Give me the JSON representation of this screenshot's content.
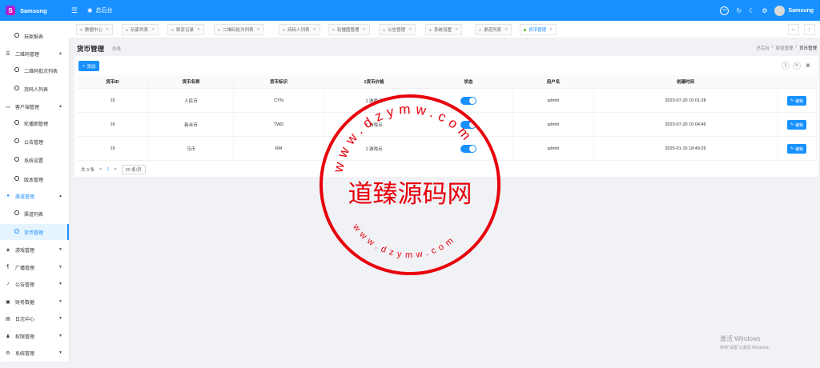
{
  "header": {
    "app_title": "Samsung",
    "crumb": "总后台",
    "user_name": "Samsung",
    "colors": {
      "primary": "#1890ff"
    }
  },
  "sidebar": {
    "items": [
      {
        "label": "玩家报表",
        "type": "child",
        "icon": "circle-icon"
      },
      {
        "label": "二维码管理",
        "type": "parent",
        "icon": "menu-icon",
        "arrow": "^"
      },
      {
        "label": "二维码批次列表",
        "type": "child",
        "icon": "circle-icon"
      },
      {
        "label": "持码人列表",
        "type": "child",
        "icon": "circle-icon"
      },
      {
        "label": "客户端管理",
        "type": "parent",
        "icon": "monitor-icon",
        "arrow": "^"
      },
      {
        "label": "轮播图管理",
        "type": "child",
        "icon": "circle-icon"
      },
      {
        "label": "公告管理",
        "type": "child",
        "icon": "circle-icon"
      },
      {
        "label": "系统设置",
        "type": "child",
        "icon": "circle-icon"
      },
      {
        "label": "版本管理",
        "type": "child",
        "icon": "circle-icon"
      },
      {
        "label": "渠道管理",
        "type": "parent",
        "icon": "globe-icon",
        "arrow": "^",
        "state": "active-parent"
      },
      {
        "label": "渠道列表",
        "type": "child",
        "icon": "circle-icon"
      },
      {
        "label": "货币管理",
        "type": "child",
        "icon": "circle-icon",
        "state": "active"
      },
      {
        "label": "游戏管理",
        "type": "parent",
        "icon": "gamepad-icon",
        "arrow": "v"
      },
      {
        "label": "广播管理",
        "type": "parent",
        "icon": "broadcast-icon",
        "arrow": "v"
      },
      {
        "label": "公告管理",
        "type": "parent",
        "icon": "bell-icon",
        "arrow": "v"
      },
      {
        "label": "财务数据",
        "type": "parent",
        "icon": "wallet-icon",
        "arrow": "v"
      },
      {
        "label": "日志中心",
        "type": "parent",
        "icon": "log-icon",
        "arrow": "v"
      },
      {
        "label": "权限管理",
        "type": "parent",
        "icon": "users-icon",
        "arrow": "v"
      },
      {
        "label": "系统管理",
        "type": "parent",
        "icon": "gear-icon",
        "arrow": "v"
      }
    ]
  },
  "tabs": [
    {
      "label": "数据中心"
    },
    {
      "label": "玩家列表"
    },
    {
      "label": "账变记录"
    },
    {
      "label": "二维码批次列表"
    },
    {
      "label": "持码人列表"
    },
    {
      "label": "轮播图管理"
    },
    {
      "label": "公告管理"
    },
    {
      "label": "系统设置"
    },
    {
      "label": "渠道列表"
    },
    {
      "label": "货币管理",
      "active": true
    }
  ],
  "page": {
    "title": "货币管理",
    "subtitle": "列表",
    "breadcrumb": [
      "总后台",
      "/",
      "渠道管理",
      "/",
      "货币管理"
    ],
    "add_label": "添加"
  },
  "table": {
    "columns": [
      "货币ID",
      "货币名称",
      "货币标识",
      "1货币价格",
      "状态",
      "用户名",
      "创建时间",
      ""
    ],
    "rows": [
      {
        "id": "15",
        "name": "人民币",
        "code": "CYN",
        "price": "1 游戏点",
        "status_on": true,
        "user": "admin",
        "created": "2023-07-20 10:01:28",
        "action": "编辑"
      },
      {
        "id": "18",
        "name": "新台币",
        "code": "TWD",
        "price": "1 游戏点",
        "status_on": true,
        "user": "admin",
        "created": "2023-07-20 10:04:46",
        "action": "编辑"
      },
      {
        "id": "19",
        "name": "马币",
        "code": "RM",
        "price": "1 游戏点",
        "status_on": true,
        "user": "admin",
        "created": "2025-01-15 18:49:26",
        "action": "编辑"
      }
    ]
  },
  "pager": {
    "total": "共 3 条",
    "prev": "<",
    "page": "1",
    "next": ">",
    "size": "20 条/页"
  },
  "watermark": {
    "center_text": "道臻源码网",
    "arc_text": "www.dzymw.com",
    "color": "#e8000b"
  },
  "windows_watermark": {
    "line1": "激活 Windows",
    "line2": "转到\"设置\"以激活 Windows。"
  }
}
